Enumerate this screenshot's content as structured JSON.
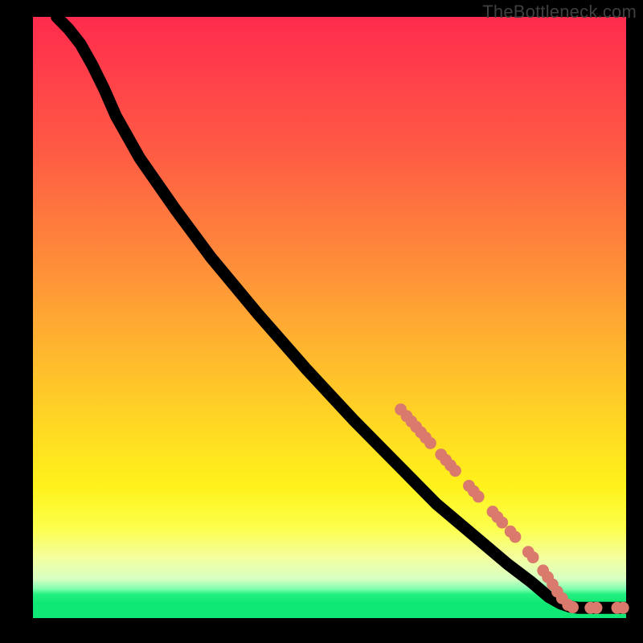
{
  "watermark": "TheBottleneck.com",
  "chart_data": {
    "type": "line",
    "title": "",
    "xlabel": "",
    "ylabel": "",
    "xlim": [
      0,
      100
    ],
    "ylim": [
      0,
      100
    ],
    "grid": false,
    "legend": false,
    "curve": {
      "comment": "Single black curve; y is inverted visually (0 top). Values as (x, y_from_top).",
      "points": [
        [
          4,
          0
        ],
        [
          6,
          2
        ],
        [
          8,
          4.5
        ],
        [
          10,
          8
        ],
        [
          12,
          12
        ],
        [
          14,
          16.5
        ],
        [
          18,
          23.5
        ],
        [
          24,
          32
        ],
        [
          30,
          40
        ],
        [
          38,
          49.5
        ],
        [
          46,
          58.5
        ],
        [
          54,
          67
        ],
        [
          62,
          75
        ],
        [
          68,
          81
        ],
        [
          74,
          86
        ],
        [
          80,
          91
        ],
        [
          84,
          94
        ],
        [
          87,
          96.5
        ],
        [
          89,
          97.6
        ],
        [
          90.5,
          98.1
        ],
        [
          92,
          98.3
        ],
        [
          95,
          98.3
        ],
        [
          98,
          98.3
        ],
        [
          100,
          98.3
        ]
      ]
    },
    "markers": {
      "color": "#d97a6d",
      "radius_pct": 1.0,
      "points": [
        [
          62.0,
          65.3
        ],
        [
          63.0,
          66.4
        ],
        [
          63.8,
          67.3
        ],
        [
          64.6,
          68.2
        ],
        [
          65.4,
          69.1
        ],
        [
          66.2,
          70.0
        ],
        [
          67.0,
          70.9
        ],
        [
          68.8,
          72.8
        ],
        [
          69.6,
          73.7
        ],
        [
          70.4,
          74.6
        ],
        [
          71.2,
          75.5
        ],
        [
          73.5,
          78.0
        ],
        [
          74.3,
          78.9
        ],
        [
          75.1,
          79.8
        ],
        [
          77.5,
          82.3
        ],
        [
          78.3,
          83.2
        ],
        [
          79.1,
          84.1
        ],
        [
          80.5,
          85.6
        ],
        [
          81.3,
          86.5
        ],
        [
          83.5,
          89.0
        ],
        [
          84.3,
          89.9
        ],
        [
          86.0,
          92.1
        ],
        [
          86.8,
          93.2
        ],
        [
          87.6,
          94.4
        ],
        [
          88.4,
          95.6
        ],
        [
          89.2,
          96.7
        ],
        [
          90.2,
          97.8
        ],
        [
          91.0,
          98.2
        ],
        [
          94.0,
          98.3
        ],
        [
          95.0,
          98.3
        ],
        [
          98.5,
          98.3
        ],
        [
          99.5,
          98.3
        ]
      ]
    }
  }
}
